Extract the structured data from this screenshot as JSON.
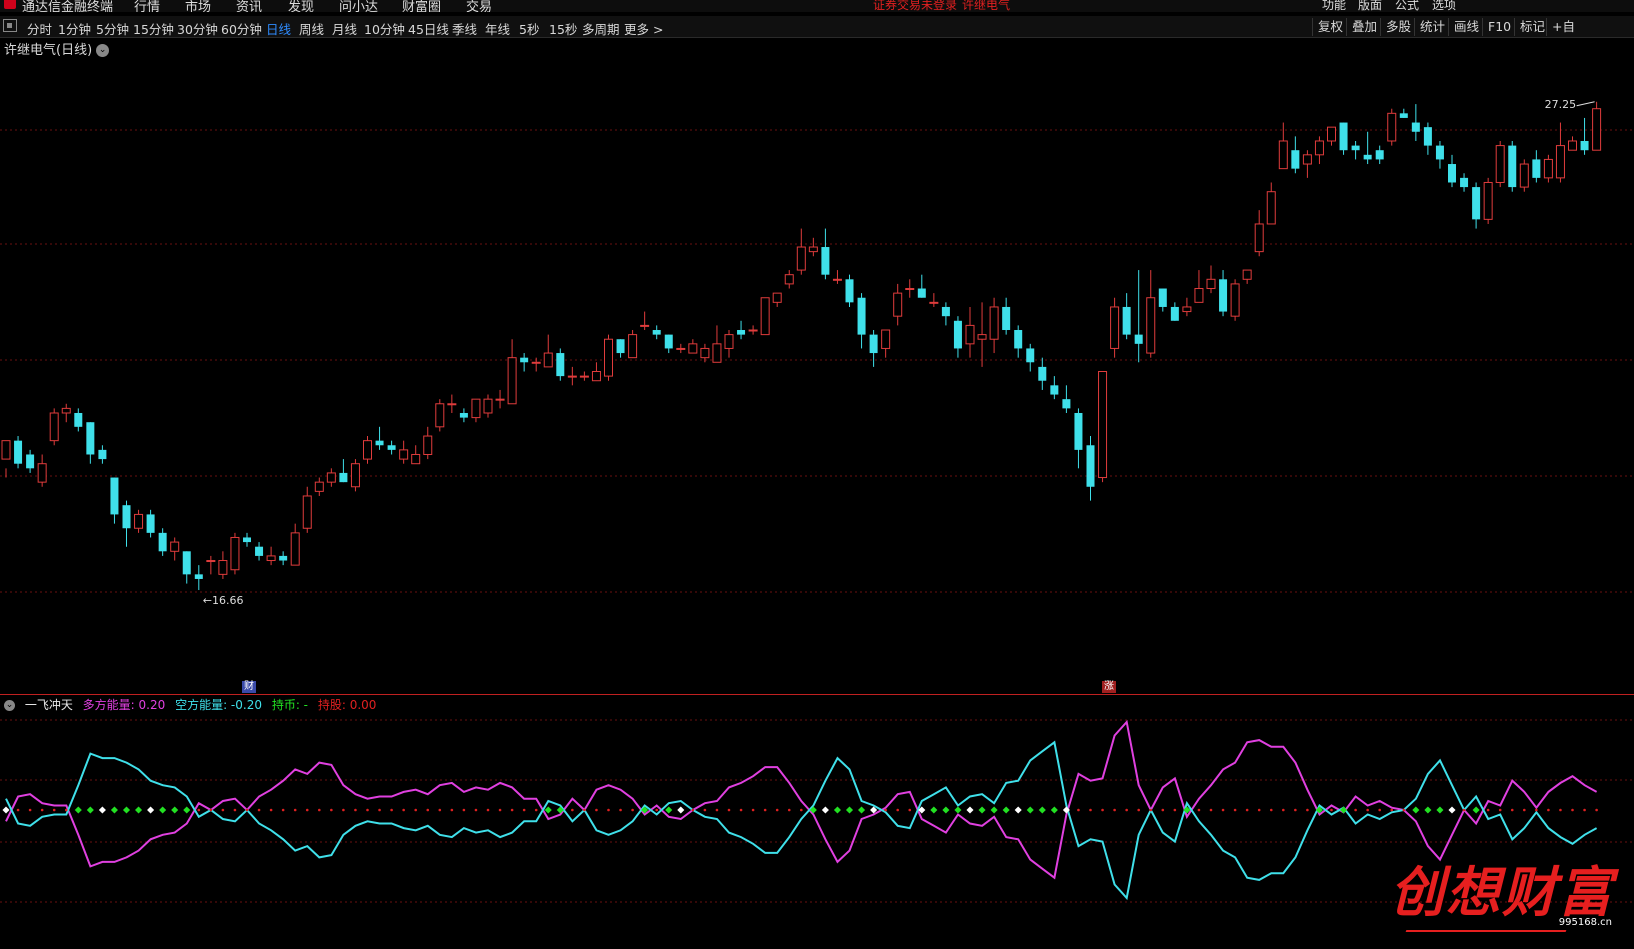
{
  "menubar": {
    "app_title": "通达信金融终端",
    "items": [
      "行情",
      "市场",
      "资讯",
      "发现",
      "问小达",
      "财富圈",
      "交易"
    ],
    "login_warning": "证券交易未登录",
    "stock_name": "许继电气",
    "right_items": [
      "功能",
      "版面",
      "公式",
      "选项"
    ]
  },
  "periods": [
    "分时",
    "1分钟",
    "5分钟",
    "15分钟",
    "30分钟",
    "60分钟",
    "日线",
    "周线",
    "月线",
    "10分钟",
    "45日线",
    "季线",
    "年线",
    "5秒",
    "15秒",
    "多周期",
    "更多 >"
  ],
  "active_period": "日线",
  "toolbar_right": [
    "复权",
    "叠加",
    "多股",
    "统计",
    "画线",
    "F10",
    "标记",
    "+自"
  ],
  "stock_label": "许继电气(日线)",
  "markers": {
    "high_label": "27.25",
    "low_label": "16.66",
    "cai": "财",
    "zhang": "涨"
  },
  "indicator": {
    "name": "一飞冲天",
    "bull_label": "多方能量: 0.20",
    "bear_label": "空方能量: -0.20",
    "hold_label": "持币: -",
    "holdstock_label": "持股: 0.00",
    "bull_color": "#e040e0",
    "bear_color": "#3fe0ea",
    "hold_color": "#22e022",
    "holdstock_color": "#e02020"
  },
  "watermark": {
    "text": "创想财富",
    "url": "995168.cn"
  },
  "colors": {
    "up": "#e03c3c",
    "down": "#3fe0ea",
    "grid": "#6a0f0f"
  },
  "chart_data": {
    "type": "candlestick",
    "ylim": [
      14.6,
      28.2
    ],
    "candles": [
      [
        19.5,
        19.9,
        19.3,
        19.1
      ],
      [
        19.9,
        19.4,
        20.0,
        19.3
      ],
      [
        19.6,
        19.3,
        19.7,
        19.2
      ],
      [
        19.0,
        19.4,
        19.6,
        18.9
      ],
      [
        19.9,
        20.5,
        20.6,
        19.8
      ],
      [
        20.5,
        20.6,
        20.7,
        20.3
      ],
      [
        20.5,
        20.2,
        20.6,
        20.1
      ],
      [
        20.3,
        19.6,
        20.3,
        19.4
      ],
      [
        19.7,
        19.5,
        19.8,
        19.4
      ],
      [
        19.1,
        18.3,
        19.1,
        18.1
      ],
      [
        18.5,
        18.0,
        18.6,
        17.6
      ],
      [
        18.0,
        18.3,
        18.4,
        17.9
      ],
      [
        18.3,
        17.9,
        18.4,
        17.8
      ],
      [
        17.9,
        17.5,
        18.0,
        17.4
      ],
      [
        17.5,
        17.7,
        17.8,
        17.3
      ],
      [
        17.5,
        17.0,
        17.5,
        16.8
      ],
      [
        17.0,
        16.9,
        17.2,
        16.66
      ],
      [
        17.3,
        17.3,
        17.4,
        17.0
      ],
      [
        17.0,
        17.3,
        17.5,
        16.9
      ],
      [
        17.1,
        17.8,
        17.9,
        17.0
      ],
      [
        17.8,
        17.7,
        17.9,
        17.6
      ],
      [
        17.6,
        17.4,
        17.7,
        17.3
      ],
      [
        17.3,
        17.4,
        17.6,
        17.2
      ],
      [
        17.4,
        17.3,
        17.5,
        17.2
      ],
      [
        17.2,
        17.9,
        18.1,
        17.2
      ],
      [
        18.0,
        18.7,
        18.9,
        17.9
      ],
      [
        18.8,
        19.0,
        19.1,
        18.7
      ],
      [
        19.0,
        19.2,
        19.3,
        18.9
      ],
      [
        19.2,
        19.0,
        19.5,
        19.0
      ],
      [
        18.9,
        19.4,
        19.5,
        18.8
      ],
      [
        19.5,
        19.9,
        20.0,
        19.4
      ],
      [
        19.9,
        19.8,
        20.2,
        19.7
      ],
      [
        19.8,
        19.7,
        19.9,
        19.6
      ],
      [
        19.5,
        19.7,
        19.9,
        19.4
      ],
      [
        19.4,
        19.6,
        19.8,
        19.4
      ],
      [
        19.6,
        20.0,
        20.2,
        19.5
      ],
      [
        20.2,
        20.7,
        20.8,
        20.1
      ],
      [
        20.7,
        20.7,
        20.9,
        20.5
      ],
      [
        20.5,
        20.4,
        20.6,
        20.3
      ],
      [
        20.4,
        20.8,
        20.8,
        20.3
      ],
      [
        20.5,
        20.8,
        20.9,
        20.4
      ],
      [
        20.8,
        20.8,
        21.0,
        20.6
      ],
      [
        20.7,
        21.7,
        22.1,
        20.7
      ],
      [
        21.7,
        21.6,
        21.8,
        21.4
      ],
      [
        21.6,
        21.6,
        21.7,
        21.4
      ],
      [
        21.5,
        21.8,
        22.2,
        21.5
      ],
      [
        21.8,
        21.3,
        21.9,
        21.2
      ],
      [
        21.3,
        21.3,
        21.5,
        21.1
      ],
      [
        21.3,
        21.3,
        21.4,
        21.2
      ],
      [
        21.2,
        21.4,
        21.6,
        21.2
      ],
      [
        21.3,
        22.1,
        22.2,
        21.2
      ],
      [
        22.1,
        21.8,
        22.1,
        21.7
      ],
      [
        21.7,
        22.2,
        22.3,
        21.7
      ],
      [
        22.4,
        22.4,
        22.7,
        22.3
      ],
      [
        22.3,
        22.2,
        22.4,
        22.1
      ],
      [
        22.2,
        21.9,
        22.2,
        21.8
      ],
      [
        21.9,
        21.9,
        22.0,
        21.8
      ],
      [
        21.8,
        22.0,
        22.1,
        21.8
      ],
      [
        21.7,
        21.9,
        22.0,
        21.6
      ],
      [
        21.6,
        22.0,
        22.4,
        21.6
      ],
      [
        21.9,
        22.2,
        22.3,
        21.7
      ],
      [
        22.3,
        22.2,
        22.5,
        22.1
      ],
      [
        22.3,
        22.3,
        22.4,
        22.2
      ],
      [
        22.2,
        23.0,
        23.0,
        22.2
      ],
      [
        22.9,
        23.1,
        23.1,
        22.8
      ],
      [
        23.3,
        23.5,
        23.6,
        23.2
      ],
      [
        23.6,
        24.1,
        24.5,
        23.5
      ],
      [
        24.0,
        24.1,
        24.3,
        23.9
      ],
      [
        24.1,
        23.5,
        24.5,
        23.4
      ],
      [
        23.4,
        23.4,
        23.6,
        23.3
      ],
      [
        23.4,
        22.9,
        23.5,
        22.8
      ],
      [
        23.0,
        22.2,
        23.1,
        21.9
      ],
      [
        22.2,
        21.8,
        22.3,
        21.5
      ],
      [
        21.9,
        22.3,
        22.3,
        21.7
      ],
      [
        22.6,
        23.1,
        23.3,
        22.4
      ],
      [
        23.2,
        23.2,
        23.4,
        23.0
      ],
      [
        23.2,
        23.0,
        23.5,
        23.0
      ],
      [
        22.9,
        22.9,
        23.1,
        22.8
      ],
      [
        22.8,
        22.6,
        22.9,
        22.4
      ],
      [
        22.5,
        21.9,
        22.6,
        21.7
      ],
      [
        22.0,
        22.4,
        22.8,
        21.7
      ],
      [
        22.1,
        22.2,
        22.9,
        21.5
      ],
      [
        22.1,
        22.8,
        23.0,
        21.8
      ],
      [
        22.8,
        22.3,
        23.0,
        22.2
      ],
      [
        22.3,
        21.9,
        22.4,
        21.7
      ],
      [
        21.9,
        21.6,
        22.0,
        21.4
      ],
      [
        21.5,
        21.2,
        21.7,
        21.0
      ],
      [
        21.1,
        20.9,
        21.3,
        20.8
      ],
      [
        20.8,
        20.6,
        21.1,
        20.5
      ],
      [
        20.5,
        19.7,
        20.6,
        19.3
      ],
      [
        19.8,
        18.9,
        20.0,
        18.6
      ],
      [
        19.1,
        21.4,
        21.4,
        19.0
      ],
      [
        21.9,
        22.8,
        23.0,
        21.7
      ],
      [
        22.8,
        22.2,
        23.1,
        22.1
      ],
      [
        22.2,
        22.0,
        23.6,
        21.6
      ],
      [
        21.8,
        23.0,
        23.6,
        21.7
      ],
      [
        23.2,
        22.8,
        23.2,
        22.7
      ],
      [
        22.8,
        22.5,
        22.9,
        22.5
      ],
      [
        22.7,
        22.8,
        23.0,
        22.6
      ],
      [
        22.9,
        23.2,
        23.6,
        22.9
      ],
      [
        23.2,
        23.4,
        23.7,
        23.1
      ],
      [
        23.4,
        22.7,
        23.6,
        22.6
      ],
      [
        22.6,
        23.3,
        23.4,
        22.5
      ],
      [
        23.4,
        23.6,
        23.6,
        23.3
      ],
      [
        24.0,
        24.6,
        24.9,
        23.9
      ],
      [
        24.6,
        25.3,
        25.5,
        24.6
      ],
      [
        25.8,
        26.4,
        26.8,
        25.8
      ],
      [
        26.2,
        25.8,
        26.5,
        25.7
      ],
      [
        25.9,
        26.1,
        26.2,
        25.6
      ],
      [
        26.1,
        26.4,
        26.5,
        25.9
      ],
      [
        26.4,
        26.7,
        26.7,
        26.3
      ],
      [
        26.8,
        26.2,
        26.8,
        26.1
      ],
      [
        26.3,
        26.2,
        26.4,
        26.0
      ],
      [
        26.1,
        26.0,
        26.6,
        25.9
      ],
      [
        26.2,
        26.0,
        26.3,
        25.9
      ],
      [
        26.4,
        27.0,
        27.1,
        26.3
      ],
      [
        27.0,
        26.9,
        27.1,
        26.9
      ],
      [
        26.8,
        26.6,
        27.2,
        26.4
      ],
      [
        26.7,
        26.3,
        26.8,
        26.1
      ],
      [
        26.3,
        26.0,
        26.4,
        25.8
      ],
      [
        25.9,
        25.5,
        26.1,
        25.4
      ],
      [
        25.6,
        25.4,
        25.7,
        25.3
      ],
      [
        25.4,
        24.7,
        25.5,
        24.5
      ],
      [
        24.7,
        25.5,
        25.6,
        24.6
      ],
      [
        25.5,
        26.3,
        26.4,
        25.4
      ],
      [
        26.3,
        25.4,
        26.4,
        25.3
      ],
      [
        25.4,
        25.9,
        26.0,
        25.3
      ],
      [
        26.0,
        25.6,
        26.2,
        25.5
      ],
      [
        25.6,
        26.0,
        26.1,
        25.5
      ],
      [
        25.6,
        26.3,
        26.8,
        25.5
      ],
      [
        26.2,
        26.4,
        26.5,
        26.2
      ],
      [
        26.4,
        26.2,
        26.9,
        26.1
      ],
      [
        26.2,
        27.1,
        27.25,
        26.2
      ]
    ]
  }
}
